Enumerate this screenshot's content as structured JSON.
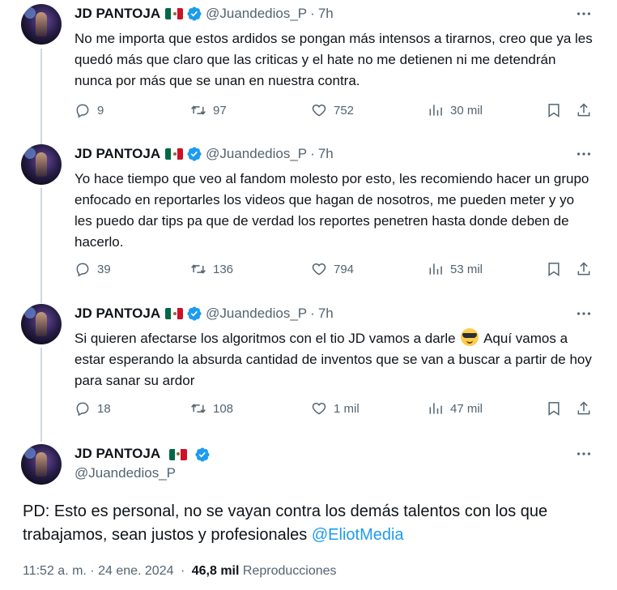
{
  "author": {
    "name": "JD PANTOJA",
    "handle": "@Juandedios_P",
    "flag_icon": "mexico-flag-icon",
    "verified_icon": "verified-badge-icon",
    "verified_color": "#1d9bf0"
  },
  "tweets": [
    {
      "time": "7h",
      "text": "No me importa que estos ardidos se pongan más intensos a tirarnos, creo que ya les quedó más que claro que las criticas y el hate no me detienen ni me detendrán nunca por más que se unan en nuestra contra.",
      "replies": "9",
      "retweets": "97",
      "likes": "752",
      "views": "30 mil"
    },
    {
      "time": "7h",
      "text": "Yo hace tiempo que veo al fandom molesto por esto, les recomiendo hacer un grupo enfocado en reportarles los videos que hagan de nosotros, me pueden meter y yo les puedo dar tips pa que de verdad los reportes penetren hasta donde deben de hacerlo.",
      "replies": "39",
      "retweets": "136",
      "likes": "794",
      "views": "53 mil"
    },
    {
      "time": "7h",
      "text_before_emoji": "Si quieren afectarse los algoritmos con el tio JD vamos a darle",
      "emoji": "smiling-face-with-sunglasses",
      "text_after_emoji": " Aquí vamos a estar esperando la absurda cantidad de inventos que se van a buscar a partir de hoy para sanar su ardor",
      "replies": "18",
      "retweets": "108",
      "likes": "1 mil",
      "views": "47 mil"
    }
  ],
  "main_tweet": {
    "text": "PD: Esto es personal, no se vayan contra los demás talentos con los que trabajamos, sean justos y profesionales ",
    "mention": "@EliotMedia",
    "timestamp": "11:52 a. m. · 24 ene. 2024",
    "views_count": "46,8 mil",
    "views_label": "Reproducciones"
  },
  "separator": "·",
  "colors": {
    "text_primary": "#0f1419",
    "text_secondary": "#536471",
    "link": "#1d9bf0",
    "thread_line": "#cfd9de"
  }
}
